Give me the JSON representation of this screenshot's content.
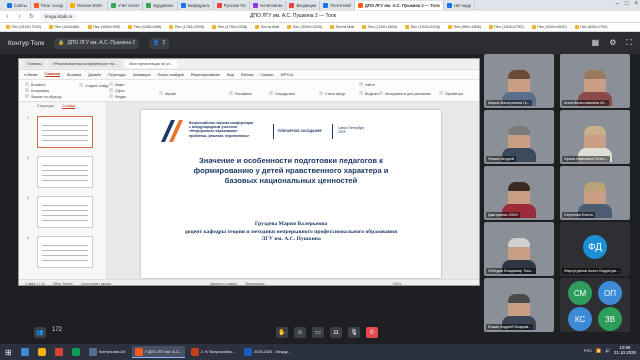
{
  "browser": {
    "tabs": [
      {
        "label": "Сайты",
        "color": "#1a73e8"
      },
      {
        "label": "Толк: съезд",
        "color": "#ff5a1f"
      },
      {
        "label": "Плагин 2025 -",
        "color": "#f9ab00"
      },
      {
        "label": "Учёт оплат",
        "color": "#34a853"
      },
      {
        "label": "Бурдоковс",
        "color": "#34a853"
      },
      {
        "label": "Кафедраль",
        "color": "#1a73e8"
      },
      {
        "label": "Русское По",
        "color": "#ea4335"
      },
      {
        "label": "Антиплагиа",
        "color": "#9334e6"
      },
      {
        "label": "Входящие",
        "color": "#ea4335"
      },
      {
        "label": "Почта Mail",
        "color": "#1a73e8"
      },
      {
        "label": "ДПО ЛГУ им. А.С. Пушкина 2 — Толк",
        "color": "#ff5a1f"
      },
      {
        "label": "Нет кадр",
        "color": "#1a73e8"
      }
    ],
    "window_title": "ДПО ЛГУ им. А.С. Пушкина 2 — Толк",
    "url": "lengu.ktalk.ru",
    "bookmarks": [
      "Пес (3100×7016)",
      "Пес (4244486)",
      "Пес (1084×995)",
      "Пес (1266×898)",
      "Пес (1784×1006)",
      "Пес (1750×2338)",
      "Почта Mail",
      "Пес (3000×2000)",
      "Почта Mail",
      "Пес (1200×1800)",
      "Пес (1515×2205)",
      "Пес (890×1368)",
      "Пес (1500×2752)",
      "Пес (3024×4032)",
      "Пес (828×1792)"
    ]
  },
  "meeting": {
    "app_title": "Контур Толк",
    "room_label": "ДПО ЛГУ им. А.С. Пушкина 2",
    "participants_count": "2",
    "total_count": "172"
  },
  "ppt": {
    "tabs": [
      "Главная",
      "«Реализованная конференция» на ...",
      "Моя презентация на уч..."
    ],
    "menu": [
      "≡ Меню",
      "Главная",
      "Вставка",
      "Дизайн",
      "Переходы",
      "Анимация",
      "Показ слайдов",
      "Рецензирование",
      "Вид",
      "Работа",
      "Сервис",
      "WPS AI"
    ],
    "ribbon": [
      "Вставить",
      "Копировать",
      "Формат по образцу",
      "Создать слайд",
      "Макет",
      "Сброс",
      "Раздел",
      "Шрифт",
      "Рисование",
      "Упорядочить",
      "Стили фигур",
      "Найти",
      "Выделить",
      "Инструменты для рисования",
      "Параметры"
    ],
    "panel_tabs": [
      "Структура",
      "Слайды"
    ],
    "status": [
      "Слайд 1 / 16",
      "Office Theme",
      "Отсутствует шрифт",
      "Заметки к слайду",
      "Примечание",
      "100%"
    ],
    "thumb_nums": [
      "1",
      "2",
      "3",
      "4"
    ]
  },
  "slide": {
    "conference": [
      "Всероссийская научная конференция",
      "с международным участием",
      "«Непрерывное образование:",
      "проблемы, решения, перспективы»"
    ],
    "plenary": "ПЛЕНАРНОЕ ЗАСЕДАНИЕ",
    "city": [
      "Санкт-Петербург",
      "2025"
    ],
    "title": [
      "Значение и особенности подготовки педагогов к",
      "формированию у детей нравственного характера и",
      "базовых национальных ценностей"
    ],
    "author": [
      "Груздева Мария Валерьевна",
      "доцент кафедры теории и методики непрерывного профессионального образования",
      "ЛГУ им. А.С. Пушкина"
    ]
  },
  "participants": [
    {
      "name": "Мария Валерьевна Гр...",
      "type": "photo",
      "hair": "#6b4a3a",
      "shirt": "#5b6e8c"
    },
    {
      "name": "Анна Вячеславовна Ит...",
      "type": "photo",
      "hair": "#9a7a5c",
      "shirt": "#8c4b4b"
    },
    {
      "name": "Фомин Андрей",
      "type": "photo",
      "hair": "#7a7a7a",
      "shirt": "#3d4a5c"
    },
    {
      "name": "Ирина Ивановна Гинео...",
      "type": "photo",
      "hair": "#c9b08a",
      "shirt": "#e0dcd6"
    },
    {
      "name": "Дмитриева ОЮО",
      "type": "photo",
      "hair": "#3a2a22",
      "shirt": "#9a2c3c"
    },
    {
      "name": "Сергеева Елена",
      "type": "photo",
      "hair": "#b9a47a",
      "shirt": "#4e5c72"
    },
    {
      "name": "Лебедев Владимир Теко...",
      "type": "photo",
      "hair": "#d0d0d0",
      "shirt": "#2f3644"
    },
    {
      "name": "Фархутдинов Асхат Бедретди...",
      "type": "initials",
      "initials": "ФД",
      "color": "#1a8fd6"
    },
    {
      "name": "Юшин Андрей Владим...",
      "type": "photo",
      "hair": "#4a4a4a",
      "shirt": "#3b4556"
    },
    {
      "name": "",
      "type": "quad",
      "initials": [
        "СМ",
        "ОП",
        "КС",
        "ЗВ"
      ],
      "colors": [
        "#2e9c5a",
        "#3d8bd6",
        "#3d8bd6",
        "#2e9c5a"
      ]
    }
  ],
  "controls": [
    "hand-icon",
    "reaction-icon",
    "screen-share-icon",
    "camera-icon",
    "microphone-icon",
    "leave-icon"
  ],
  "taskbar": {
    "items": [
      {
        "label": "",
        "color": "#3d8bd6"
      },
      {
        "label": "",
        "color": "#f4b400"
      },
      {
        "label": "",
        "color": "#db4437"
      },
      {
        "label": "",
        "color": "#0f9d58"
      },
      {
        "label": "Контульная-АЛ",
        "color": "#5b6e8c"
      },
      {
        "label": "У ДПО ЛГУ им. А.С...",
        "color": "#ff5a1f"
      },
      {
        "label": "2. IV Всероссийск...",
        "color": "#c43e1c"
      },
      {
        "label": "2025-2026 - Между...",
        "color": "#185abd"
      }
    ],
    "lang": "РУС",
    "time": "10:59",
    "date": "21.10.2025"
  }
}
